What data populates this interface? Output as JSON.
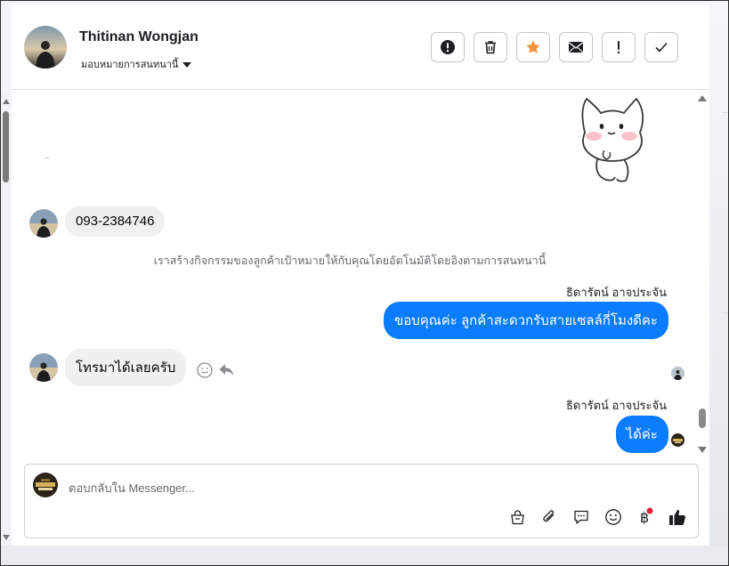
{
  "contact": {
    "name": "Thitinan Wongjan",
    "assign_label": "มอบหมายการสนทนานี้"
  },
  "toolbar": {
    "spam_icon": "alert-circle-icon",
    "delete_icon": "trash-icon",
    "star_icon": "star-icon",
    "mark_unread_icon": "envelope-icon",
    "follow_up_icon": "exclamation-icon",
    "done_icon": "check-icon",
    "star_color": "#f7923a"
  },
  "messages": [
    {
      "from": "contact",
      "type": "text",
      "text": "093-2384746"
    },
    {
      "from": "system",
      "type": "note",
      "text": "เราสร้างกิจกรรมของลูกค้าเป้าหมายให้กับคุณโดยอัตโนมัติโดยอิงตามการสนทนานี้"
    },
    {
      "from": "page",
      "sender": "ธิดารัตน์ อาจประจัน",
      "type": "text",
      "text": "ขอบคุณค่ะ ลูกค้าสะดวกรับสายเซลล์กี่โมงดีคะ"
    },
    {
      "from": "contact",
      "type": "text",
      "text": "โทรมาได้เลยครับ"
    },
    {
      "from": "page",
      "sender": "ธิดารัตน์ อาจประจัน",
      "type": "text",
      "text": "ได้ค่ะ"
    }
  ],
  "message_actions": {
    "react_icon": "smiley-icon",
    "reply_icon": "reply-arrow-icon"
  },
  "composer": {
    "placeholder": "ตอบกลับใน Messenger...",
    "tools": [
      "shopping-bag-icon",
      "paperclip-icon",
      "saved-reply-icon",
      "emoji-icon",
      "baht-payment-icon",
      "thumbs-up-icon"
    ],
    "payment_badge_color": "#e41e3f"
  },
  "colors": {
    "outgoing_bubble": "#0a7cff",
    "incoming_bubble": "#f0f0f0"
  }
}
